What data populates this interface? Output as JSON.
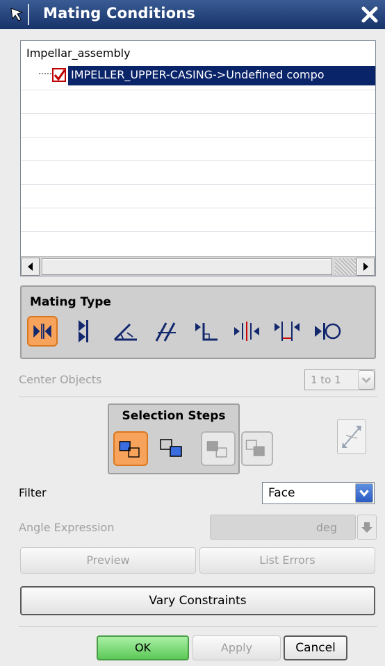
{
  "window": {
    "title": "Mating Conditions",
    "colors": {
      "titlebar": "#1f3b73",
      "selection": "#0a246a",
      "active_icon": "#f7a35c",
      "ok_button": "#66cc61"
    }
  },
  "tree": {
    "root": "Impellar_assembly",
    "items": [
      {
        "label": "IMPELLER_UPPER-CASING->Undefined compo",
        "checked": true,
        "selected": true
      }
    ]
  },
  "mating_type": {
    "label": "Mating Type",
    "icons": [
      "mate-icon",
      "align-icon",
      "angle-icon",
      "parallel-icon",
      "perpendicular-icon",
      "center-icon",
      "distance-icon",
      "tangent-icon"
    ],
    "selected": "mate-icon"
  },
  "center_objects": {
    "label": "Center Objects",
    "value": "1 to 1"
  },
  "selection_steps": {
    "label": "Selection Steps",
    "icons": [
      "from-object-icon",
      "to-object-icon",
      "second-from-icon",
      "second-to-icon"
    ]
  },
  "filter": {
    "label": "Filter",
    "value": "Face"
  },
  "angle_expression": {
    "label": "Angle Expression",
    "unit": "deg"
  },
  "buttons": {
    "preview": "Preview",
    "list_errors": "List Errors",
    "vary_constraints": "Vary Constraints",
    "ok": "OK",
    "apply": "Apply",
    "cancel": "Cancel"
  }
}
